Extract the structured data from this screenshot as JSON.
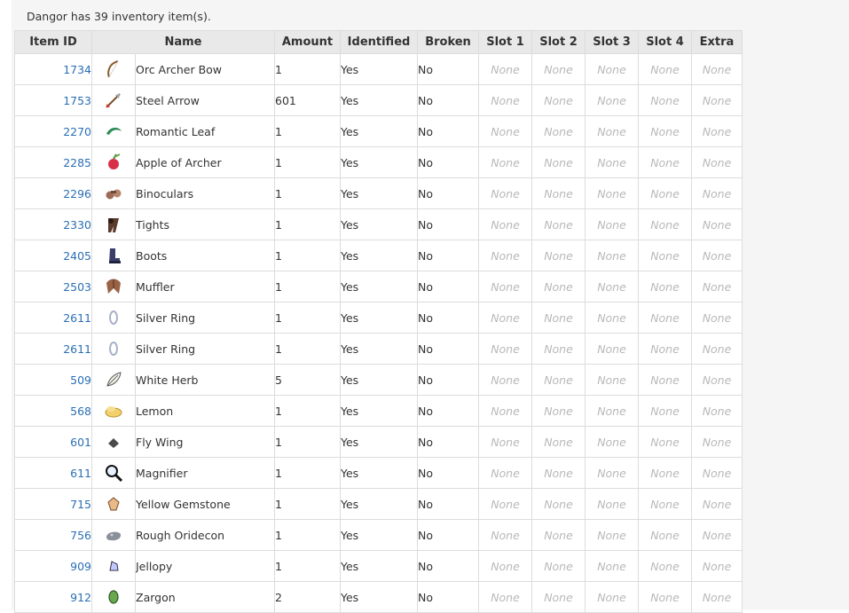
{
  "summary_text": "Dangor has 39 inventory item(s).",
  "columns": {
    "item_id": "Item ID",
    "name": "Name",
    "amount": "Amount",
    "identified": "Identified",
    "broken": "Broken",
    "slot1": "Slot 1",
    "slot2": "Slot 2",
    "slot3": "Slot 3",
    "slot4": "Slot 4",
    "extra": "Extra"
  },
  "colors": {
    "link": "#2a6fb5",
    "none_text": "#b8b8b8",
    "header_bg": "#e9e9e9",
    "page_bg": "#f5f5f5"
  },
  "items": [
    {
      "id": "1734",
      "icon": "bow-icon",
      "name": "Orc Archer Bow",
      "amount": "1",
      "identified": "Yes",
      "broken": "No",
      "slot1": "None",
      "slot2": "None",
      "slot3": "None",
      "slot4": "None",
      "extra": "None"
    },
    {
      "id": "1753",
      "icon": "arrow-icon",
      "name": "Steel Arrow",
      "amount": "601",
      "identified": "Yes",
      "broken": "No",
      "slot1": "None",
      "slot2": "None",
      "slot3": "None",
      "slot4": "None",
      "extra": "None"
    },
    {
      "id": "2270",
      "icon": "leaf-icon",
      "name": "Romantic Leaf",
      "amount": "1",
      "identified": "Yes",
      "broken": "No",
      "slot1": "None",
      "slot2": "None",
      "slot3": "None",
      "slot4": "None",
      "extra": "None"
    },
    {
      "id": "2285",
      "icon": "apple-icon",
      "name": "Apple of Archer",
      "amount": "1",
      "identified": "Yes",
      "broken": "No",
      "slot1": "None",
      "slot2": "None",
      "slot3": "None",
      "slot4": "None",
      "extra": "None"
    },
    {
      "id": "2296",
      "icon": "binoculars-icon",
      "name": "Binoculars",
      "amount": "1",
      "identified": "Yes",
      "broken": "No",
      "slot1": "None",
      "slot2": "None",
      "slot3": "None",
      "slot4": "None",
      "extra": "None"
    },
    {
      "id": "2330",
      "icon": "tights-icon",
      "name": "Tights",
      "amount": "1",
      "identified": "Yes",
      "broken": "No",
      "slot1": "None",
      "slot2": "None",
      "slot3": "None",
      "slot4": "None",
      "extra": "None"
    },
    {
      "id": "2405",
      "icon": "boots-icon",
      "name": "Boots",
      "amount": "1",
      "identified": "Yes",
      "broken": "No",
      "slot1": "None",
      "slot2": "None",
      "slot3": "None",
      "slot4": "None",
      "extra": "None"
    },
    {
      "id": "2503",
      "icon": "muffler-icon",
      "name": "Muffler",
      "amount": "1",
      "identified": "Yes",
      "broken": "No",
      "slot1": "None",
      "slot2": "None",
      "slot3": "None",
      "slot4": "None",
      "extra": "None"
    },
    {
      "id": "2611",
      "icon": "ring-icon",
      "name": "Silver Ring",
      "amount": "1",
      "identified": "Yes",
      "broken": "No",
      "slot1": "None",
      "slot2": "None",
      "slot3": "None",
      "slot4": "None",
      "extra": "None"
    },
    {
      "id": "2611",
      "icon": "ring-icon",
      "name": "Silver Ring",
      "amount": "1",
      "identified": "Yes",
      "broken": "No",
      "slot1": "None",
      "slot2": "None",
      "slot3": "None",
      "slot4": "None",
      "extra": "None"
    },
    {
      "id": "509",
      "icon": "herb-icon",
      "name": "White Herb",
      "amount": "5",
      "identified": "Yes",
      "broken": "No",
      "slot1": "None",
      "slot2": "None",
      "slot3": "None",
      "slot4": "None",
      "extra": "None"
    },
    {
      "id": "568",
      "icon": "lemon-icon",
      "name": "Lemon",
      "amount": "1",
      "identified": "Yes",
      "broken": "No",
      "slot1": "None",
      "slot2": "None",
      "slot3": "None",
      "slot4": "None",
      "extra": "None"
    },
    {
      "id": "601",
      "icon": "wing-icon",
      "name": "Fly Wing",
      "amount": "1",
      "identified": "Yes",
      "broken": "No",
      "slot1": "None",
      "slot2": "None",
      "slot3": "None",
      "slot4": "None",
      "extra": "None"
    },
    {
      "id": "611",
      "icon": "magnifier-icon",
      "name": "Magnifier",
      "amount": "1",
      "identified": "Yes",
      "broken": "No",
      "slot1": "None",
      "slot2": "None",
      "slot3": "None",
      "slot4": "None",
      "extra": "None"
    },
    {
      "id": "715",
      "icon": "gemstone-icon",
      "name": "Yellow Gemstone",
      "amount": "1",
      "identified": "Yes",
      "broken": "No",
      "slot1": "None",
      "slot2": "None",
      "slot3": "None",
      "slot4": "None",
      "extra": "None"
    },
    {
      "id": "756",
      "icon": "ore-icon",
      "name": "Rough Oridecon",
      "amount": "1",
      "identified": "Yes",
      "broken": "No",
      "slot1": "None",
      "slot2": "None",
      "slot3": "None",
      "slot4": "None",
      "extra": "None"
    },
    {
      "id": "909",
      "icon": "jellopy-icon",
      "name": "Jellopy",
      "amount": "1",
      "identified": "Yes",
      "broken": "No",
      "slot1": "None",
      "slot2": "None",
      "slot3": "None",
      "slot4": "None",
      "extra": "None"
    },
    {
      "id": "912",
      "icon": "zargon-icon",
      "name": "Zargon",
      "amount": "2",
      "identified": "Yes",
      "broken": "No",
      "slot1": "None",
      "slot2": "None",
      "slot3": "None",
      "slot4": "None",
      "extra": "None"
    }
  ]
}
